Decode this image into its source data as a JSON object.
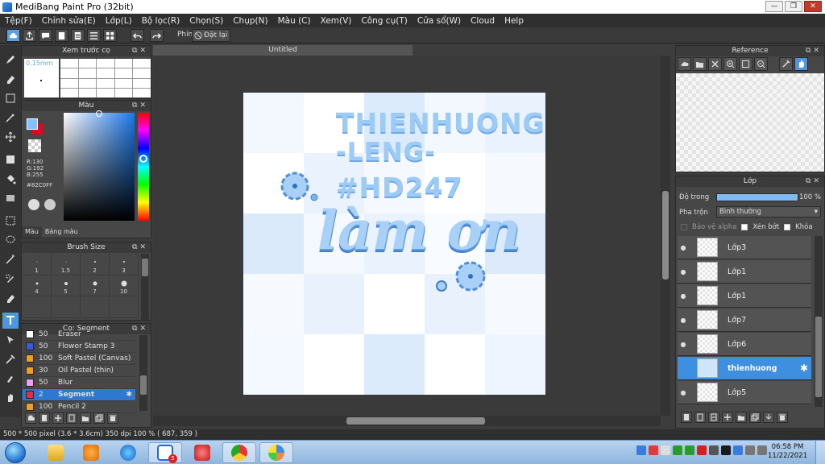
{
  "window": {
    "title": "MediBang Paint Pro (32bit)",
    "min": "—",
    "max": "❐",
    "close": "✕"
  },
  "menu": [
    "Tệp(F)",
    "Chỉnh sửa(E)",
    "Lớp(L)",
    "Bộ lọc(R)",
    "Chọn(S)",
    "Chụp(N)",
    "Màu (C)",
    "Xem(V)",
    "Công cụ(T)",
    "Cửa sổ(W)",
    "Cloud",
    "Help"
  ],
  "toolbar": {
    "shortcut_label": "Phím",
    "reset_label": "Đặt lại"
  },
  "brush_preview": {
    "title": "Xem trước cọ",
    "size": "0.15mm"
  },
  "color_panel": {
    "title": "Màu",
    "r": "R:130",
    "g": "G:192",
    "b": "B:255",
    "hex": "#82C0FF",
    "tab_color": "Màu",
    "tab_palette": "Bảng màu",
    "fg": "#82c0ff",
    "bg": "#e8001e"
  },
  "brush_size": {
    "title": "Brush Size",
    "sizes": [
      "1",
      "1.5",
      "2",
      "3",
      "4",
      "5",
      "7",
      "10"
    ]
  },
  "brush_list": {
    "title": "Cọ: Segment",
    "items": [
      {
        "size": "50",
        "name": "Eraser",
        "color": "#ffffff"
      },
      {
        "size": "50",
        "name": "Flower Stamp 3",
        "color": "#3b5bd6"
      },
      {
        "size": "100",
        "name": "Soft Pastel (Canvas)",
        "color": "#f0a020"
      },
      {
        "size": "30",
        "name": "Oil Pastel (thin)",
        "color": "#f0a020"
      },
      {
        "size": "50",
        "name": "Blur",
        "color": "#f0a0f0"
      },
      {
        "size": "2",
        "name": "Segment",
        "color": "#e03040"
      },
      {
        "size": "100",
        "name": "Pencil 2",
        "color": "#f0a020"
      }
    ]
  },
  "document": {
    "tab": "Untitled"
  },
  "artwork": {
    "line1": "THIENHUONG",
    "line2": "-LENG-",
    "line3": "#HD247",
    "script": "làm ơn"
  },
  "reference_panel": {
    "title": "Reference"
  },
  "layer_panel": {
    "title": "Lớp",
    "opacity_label": "Độ trong",
    "opacity_value": "100 %",
    "opacity": 1.0,
    "blend_label": "Pha trộn",
    "blend_value": "Bình thường",
    "protect_alpha": "Bảo vệ alpha",
    "clipping": "Xén bớt",
    "lock": "Khóa",
    "layers": [
      {
        "name": "Lớp3"
      },
      {
        "name": "Lớp1"
      },
      {
        "name": "Lớp1"
      },
      {
        "name": "Lớp7"
      },
      {
        "name": "Lớp6"
      },
      {
        "name": "thienhuong"
      },
      {
        "name": "Lớp5"
      }
    ]
  },
  "status": {
    "text": "500 * 500 pixel   (3.6 * 3.6cm)   350 dpi   100 %   ( 687, 359 )"
  },
  "taskbar": {
    "time": "06:58 PM",
    "date": "11/22/2021",
    "zalo_badge": "5"
  }
}
